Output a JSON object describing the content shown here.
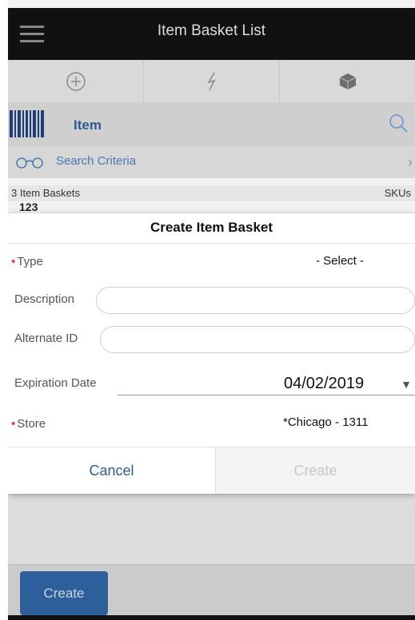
{
  "header": {
    "title": "Item Basket List"
  },
  "tabs": [
    {
      "icon": "plus-circle-icon"
    },
    {
      "icon": "lightning-icon"
    },
    {
      "icon": "cube-icon"
    }
  ],
  "item_row": {
    "label": "Item"
  },
  "search_criteria": {
    "label": "Search Criteria"
  },
  "list": {
    "count_label": "3 Item Baskets",
    "skus_label": "SKUs",
    "first_item_peek": "123"
  },
  "dialog": {
    "title": "Create Item Basket",
    "type_label": "Type",
    "type_value": "- Select -",
    "description_label": "Description",
    "description_value": "",
    "alternate_id_label": "Alternate ID",
    "alternate_id_value": "",
    "expiration_label": "Expiration Date",
    "expiration_value": "04/02/2019",
    "store_label": "Store",
    "store_value": "*Chicago - 1311",
    "cancel_label": "Cancel",
    "create_label": "Create"
  },
  "footer": {
    "create_label": "Create"
  },
  "colors": {
    "header_bg": "#111111",
    "accent": "#2c5a93",
    "required": "#e23b3b"
  }
}
